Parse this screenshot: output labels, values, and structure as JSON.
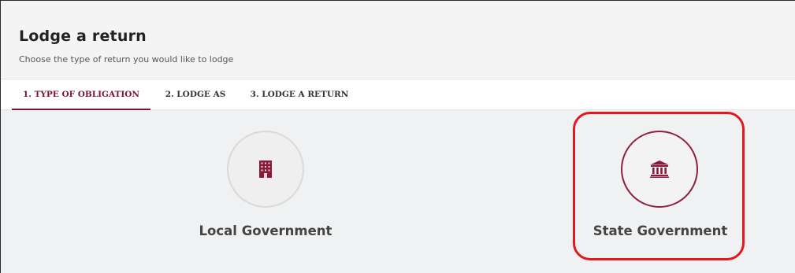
{
  "header": {
    "title": "Lodge a return",
    "subtitle": "Choose the type of return you would like to lodge"
  },
  "tabs": [
    {
      "label": "1. TYPE OF OBLIGATION",
      "active": true
    },
    {
      "label": "2. LODGE AS",
      "active": false
    },
    {
      "label": "3. LODGE A RETURN",
      "active": false
    }
  ],
  "options": [
    {
      "label": "Local Government",
      "icon": "building-icon"
    },
    {
      "label": "State Government",
      "icon": "bank-icon",
      "selected": true
    }
  ],
  "colors": {
    "accent": "#7a1530",
    "highlight": "#e3181f",
    "background": "#eff1f2"
  }
}
